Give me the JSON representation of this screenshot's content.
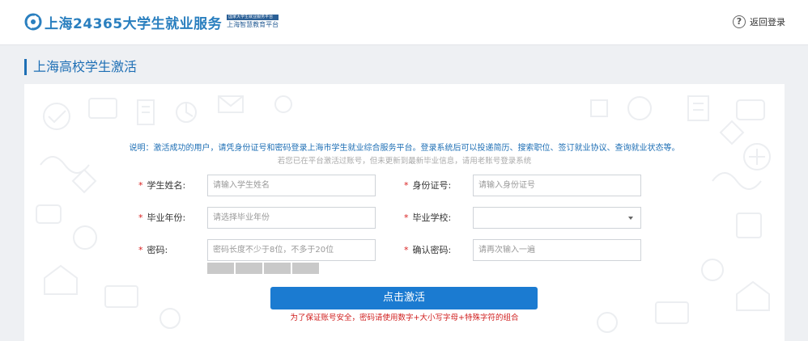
{
  "header": {
    "logo_title": "上海24365大学生就业服务",
    "logo_tag_top": "国家大学生就业服务平台",
    "logo_tag_bottom": "上海智慧教育平台",
    "back_label": "返回登录",
    "help_glyph": "?",
    "help_icon": "question-circle-icon"
  },
  "page": {
    "title": "上海高校学生激活"
  },
  "form": {
    "note": "说明：激活成功的用户，请凭身份证号和密码登录上海市学生就业综合服务平台。登录系统后可以投递简历、搜索职位、签订就业协议、查询就业状态等。",
    "note_sub": "若您已在平台激活过账号，但未更新到最新毕业信息，请用老账号登录系统",
    "required_mark": "*",
    "name": {
      "label": "学生姓名:",
      "placeholder": "请输入学生姓名",
      "value": ""
    },
    "id_number": {
      "label": "身份证号:",
      "placeholder": "请输入身份证号",
      "value": ""
    },
    "grad_year": {
      "label": "毕业年份:",
      "placeholder": "请选择毕业年份",
      "value": ""
    },
    "grad_school": {
      "label": "毕业学校:",
      "value": ""
    },
    "password": {
      "label": "密码:",
      "placeholder": "密码长度不少于8位，不多于20位",
      "value": ""
    },
    "confirm_password": {
      "label": "确认密码:",
      "placeholder": "请再次输入一遍",
      "value": ""
    },
    "password_strength_level": 0,
    "submit_label": "点击激活",
    "warning": "为了保证账号安全，密码请使用数字+大小写字母+特殊字符的组合"
  },
  "colors": {
    "brand": "#1e6fb5",
    "button": "#1b7bd1",
    "required": "#d92020",
    "warning": "#d02020"
  }
}
